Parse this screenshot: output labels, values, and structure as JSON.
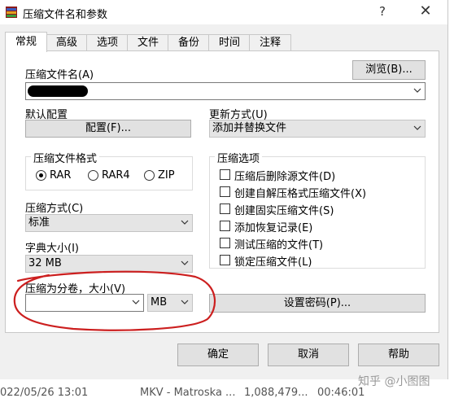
{
  "window": {
    "title": "压缩文件名和参数",
    "help_glyph": "?",
    "close_glyph": "✕"
  },
  "tabs": [
    "常规",
    "高级",
    "选项",
    "文件",
    "备份",
    "时间",
    "注释"
  ],
  "general": {
    "archive_name_label": "压缩文件名(A)",
    "browse_label": "浏览(B)...",
    "default_profile_label": "默认配置",
    "profiles_button_label": "配置(F)...",
    "update_mode_label": "更新方式(U)",
    "update_mode_value": "添加并替换文件",
    "format_group_title": "压缩文件格式",
    "format_options": [
      "RAR",
      "RAR4",
      "ZIP"
    ],
    "format_selected": "RAR",
    "method_label": "压缩方式(C)",
    "method_value": "标准",
    "dict_label": "字典大小(I)",
    "dict_value": "32 MB",
    "split_label": "压缩为分卷，大小(V)",
    "split_value": "",
    "split_unit": "MB",
    "password_button_label": "设置密码(P)...",
    "options_group_title": "压缩选项",
    "options": [
      "压缩后删除源文件(D)",
      "创建自解压格式压缩文件(X)",
      "创建固实压缩文件(S)",
      "添加恢复记录(E)",
      "测试压缩的文件(T)",
      "锁定压缩文件(L)"
    ]
  },
  "footer": {
    "ok_label": "确定",
    "cancel_label": "取消",
    "help_label": "帮助"
  },
  "background_row": {
    "date": "022/05/26 13:01",
    "type": "MKV - Matroska ...",
    "size": "1,088,479...",
    "duration": "00:46:01",
    "watermark": "知乎 @小图图"
  },
  "colors": {
    "annotation_red": "#cc1f1f",
    "redaction_black": "#000000"
  }
}
